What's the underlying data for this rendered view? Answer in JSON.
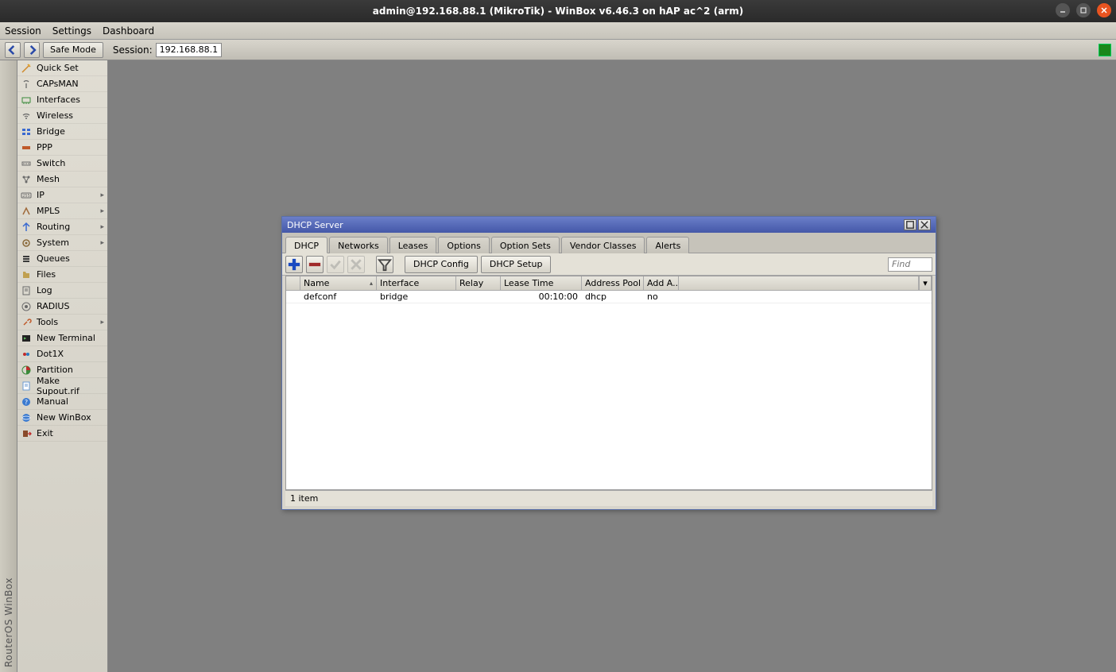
{
  "titlebar": {
    "text": "admin@192.168.88.1 (MikroTik) - WinBox v6.46.3 on hAP ac^2 (arm)"
  },
  "menubar": {
    "session": "Session",
    "settings": "Settings",
    "dashboard": "Dashboard"
  },
  "toolbar": {
    "safemode": "Safe Mode",
    "session_label": "Session:",
    "session_ip": "192.168.88.1"
  },
  "leftrail": "RouterOS WinBox",
  "sidebar": [
    {
      "label": "Quick Set",
      "icon": "wand",
      "sub": false
    },
    {
      "label": "CAPsMAN",
      "icon": "antenna",
      "sub": false
    },
    {
      "label": "Interfaces",
      "icon": "interfaces",
      "sub": false
    },
    {
      "label": "Wireless",
      "icon": "wifi",
      "sub": false
    },
    {
      "label": "Bridge",
      "icon": "bridge",
      "sub": false
    },
    {
      "label": "PPP",
      "icon": "ppp",
      "sub": false
    },
    {
      "label": "Switch",
      "icon": "switch",
      "sub": false
    },
    {
      "label": "Mesh",
      "icon": "mesh",
      "sub": false
    },
    {
      "label": "IP",
      "icon": "ip",
      "sub": true
    },
    {
      "label": "MPLS",
      "icon": "mpls",
      "sub": true
    },
    {
      "label": "Routing",
      "icon": "routing",
      "sub": true
    },
    {
      "label": "System",
      "icon": "system",
      "sub": true
    },
    {
      "label": "Queues",
      "icon": "queues",
      "sub": false
    },
    {
      "label": "Files",
      "icon": "files",
      "sub": false
    },
    {
      "label": "Log",
      "icon": "log",
      "sub": false
    },
    {
      "label": "RADIUS",
      "icon": "radius",
      "sub": false
    },
    {
      "label": "Tools",
      "icon": "tools",
      "sub": true
    },
    {
      "label": "New Terminal",
      "icon": "terminal",
      "sub": false
    },
    {
      "label": "Dot1X",
      "icon": "dot1x",
      "sub": false
    },
    {
      "label": "Partition",
      "icon": "partition",
      "sub": false
    },
    {
      "label": "Make Supout.rif",
      "icon": "supout",
      "sub": false
    },
    {
      "label": "Manual",
      "icon": "manual",
      "sub": false
    },
    {
      "label": "New WinBox",
      "icon": "winbox",
      "sub": false
    },
    {
      "label": "Exit",
      "icon": "exit",
      "sub": false
    }
  ],
  "window": {
    "title": "DHCP Server",
    "tabs": [
      "DHCP",
      "Networks",
      "Leases",
      "Options",
      "Option Sets",
      "Vendor Classes",
      "Alerts"
    ],
    "active_tab": 0,
    "buttons": {
      "config": "DHCP Config",
      "setup": "DHCP Setup"
    },
    "find_placeholder": "Find",
    "columns": [
      "",
      "Name",
      "Interface",
      "Relay",
      "Lease Time",
      "Address Pool",
      "Add A..."
    ],
    "rows": [
      {
        "name": "defconf",
        "interface": "bridge",
        "relay": "",
        "lease": "00:10:00",
        "pool": "dhcp",
        "addarp": "no"
      }
    ],
    "status": "1 item"
  },
  "iconcolors": {
    "wand": "#d08a2a",
    "antenna": "#6a6a6a",
    "interfaces": "#3a8a3a",
    "wifi": "#6a6a6a",
    "bridge": "#3a6ad0",
    "ppp": "#c05a2a",
    "switch": "#6a6a6a",
    "mesh": "#6a6a6a",
    "ip": "#6a6a6a",
    "mpls": "#a06a3a",
    "routing": "#3a6ad0",
    "system": "#8a6a3a",
    "queues": "#3a3a3a",
    "files": "#c0a050",
    "log": "#6a6a6a",
    "radius": "#6a6a6a",
    "tools": "#c05a2a",
    "terminal": "#3a3a3a",
    "dot1x": "#c02a2a",
    "partition": "#3a8a3a",
    "supout": "#6a9ad0",
    "manual": "#3a6ad0",
    "winbox": "#3a6ad0",
    "exit": "#8a4a2a"
  }
}
